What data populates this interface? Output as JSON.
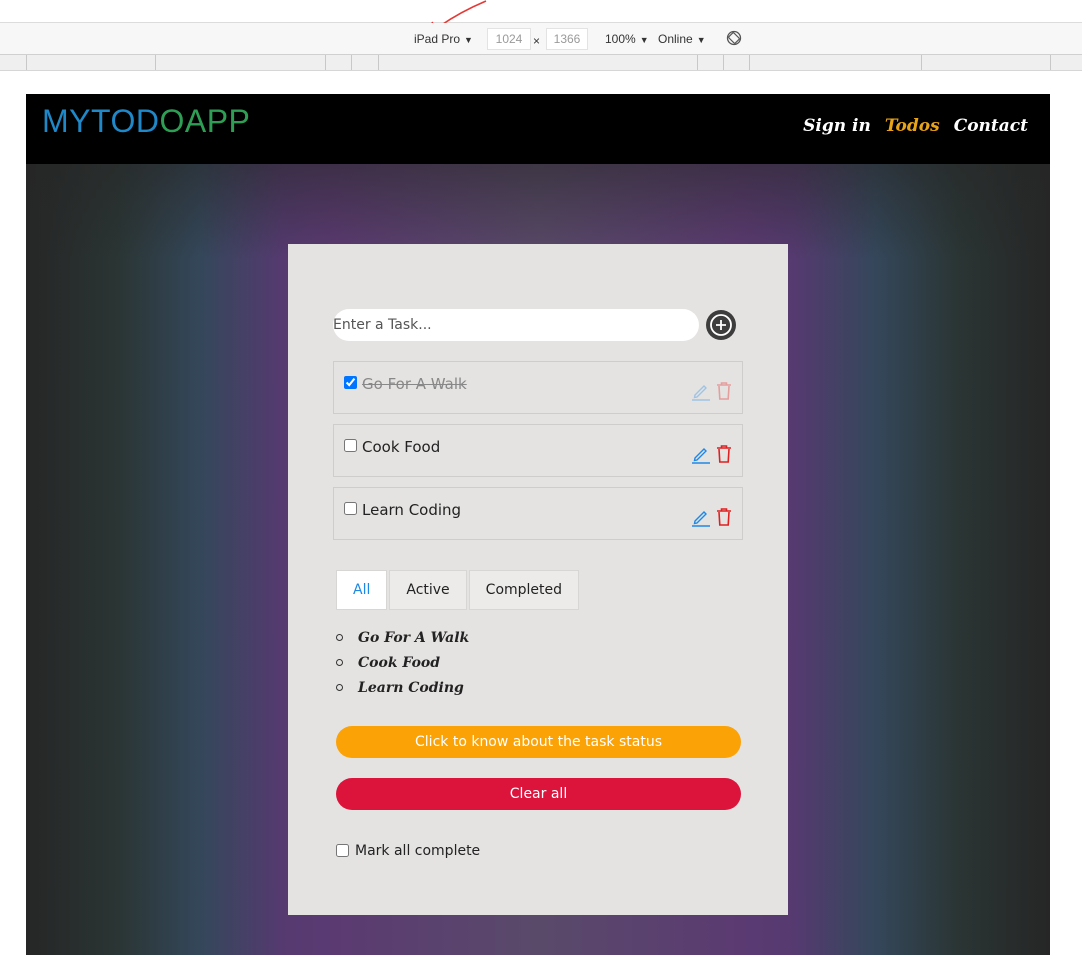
{
  "devtools": {
    "device": "iPad Pro",
    "width": "1024",
    "times": "×",
    "height": "1366",
    "zoom": "100%",
    "network": "Online",
    "caret": "▼"
  },
  "app": {
    "logo_part1": "MYTOD",
    "logo_part2": "OAPP",
    "nav": [
      {
        "label": "Sign in"
      },
      {
        "label": "Todos"
      },
      {
        "label": "Contact"
      }
    ],
    "input_placeholder": "Enter a Task...",
    "todos": [
      {
        "text": "Go For A Walk",
        "completed": true
      },
      {
        "text": "Cook Food",
        "completed": false
      },
      {
        "text": "Learn Coding",
        "completed": false
      }
    ],
    "filters": [
      {
        "label": "All"
      },
      {
        "label": "Active"
      },
      {
        "label": "Completed"
      }
    ],
    "summary": [
      "Go For A Walk",
      "Cook Food",
      "Learn Coding"
    ],
    "status_button": "Click to know about the task status",
    "clear_button": "Clear all",
    "mark_all_label": "Mark all complete",
    "colors": {
      "logo_blue": "#1e88c8",
      "logo_green": "#2e9e55",
      "nav_active": "#e8a317",
      "status_btn": "#fba207",
      "clear_btn": "#dc143c",
      "edit_icon": "#1e88e5",
      "delete_icon": "#e02020"
    }
  }
}
